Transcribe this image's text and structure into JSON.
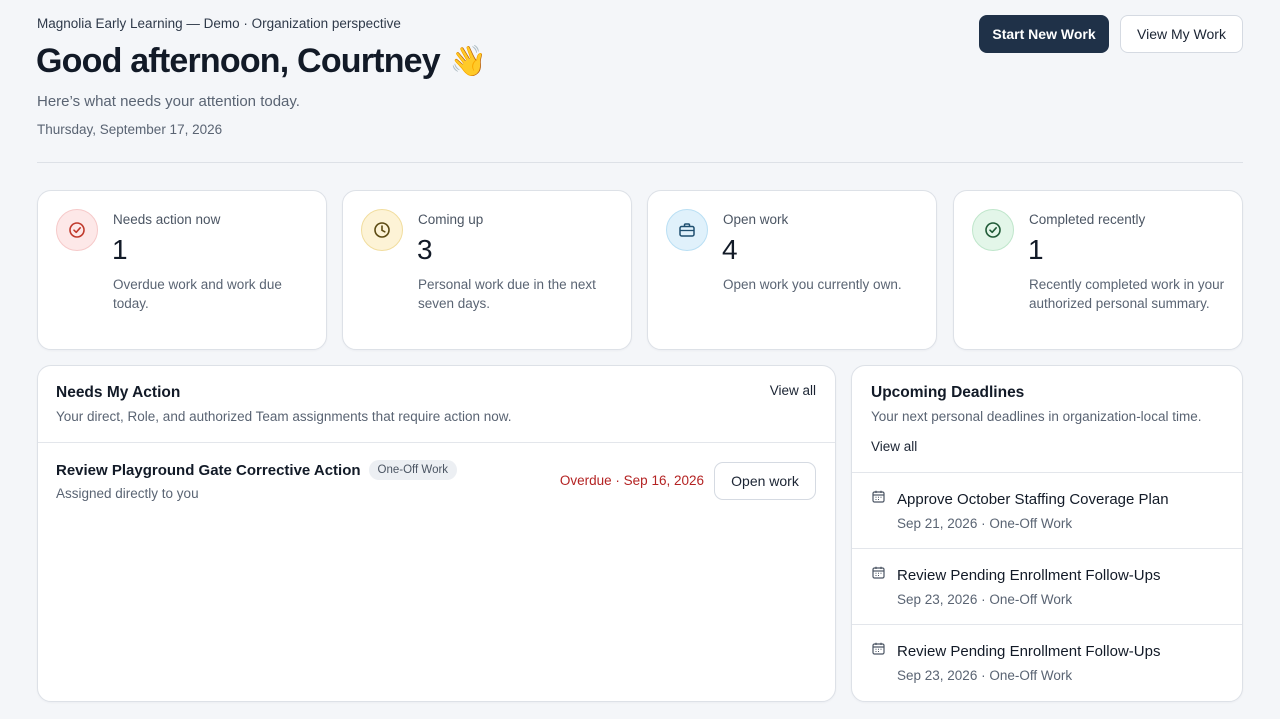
{
  "header": {
    "org_line": "Magnolia Early Learning — Demo · Organization perspective",
    "greeting": "Good afternoon, Courtney",
    "greeting_emoji": "👋",
    "subtitle": "Here’s what needs your attention today.",
    "date": "Thursday, September 17, 2026",
    "start_new_work_label": "Start New Work",
    "view_my_work_label": "View My Work"
  },
  "stats": [
    {
      "label": "Needs action now",
      "value": "1",
      "description": "Overdue work and work due today.",
      "icon": "alert-check-icon",
      "color": "#c0392b",
      "bg": "#fde8e8"
    },
    {
      "label": "Coming up",
      "value": "3",
      "description": "Personal work due in the next seven days.",
      "icon": "clock-icon",
      "color": "#8a6a10",
      "bg": "#fdf3d6"
    },
    {
      "label": "Open work",
      "value": "4",
      "description": "Open work you currently own.",
      "icon": "briefcase-icon",
      "color": "#1f6f9f",
      "bg": "#e0f1fb"
    },
    {
      "label": "Completed recently",
      "value": "1",
      "description": "Recently completed work in your authorized personal summary.",
      "icon": "check-circle-icon",
      "color": "#2b8a4e",
      "bg": "#e3f6e9"
    }
  ],
  "needs_action": {
    "title": "Needs My Action",
    "subtitle": "Your direct, Role, and authorized Team assignments that require action now.",
    "view_all_label": "View all",
    "items": [
      {
        "title": "Review Playground Gate Corrective Action",
        "chip": "One-Off Work",
        "assignment": "Assigned directly to you",
        "status": "Overdue · Sep 16, 2026",
        "action_label": "Open work"
      }
    ]
  },
  "deadlines": {
    "title": "Upcoming Deadlines",
    "subtitle": "Your next personal deadlines in organization-local time.",
    "view_all_label": "View all",
    "items": [
      {
        "title": "Approve October Staffing Coverage Plan",
        "meta": "Sep 21, 2026 · One-Off Work"
      },
      {
        "title": "Review Pending Enrollment Follow-Ups",
        "meta": "Sep 23, 2026 · One-Off Work"
      },
      {
        "title": "Review Pending Enrollment Follow-Ups",
        "meta": "Sep 23, 2026 · One-Off Work"
      }
    ]
  },
  "colors": {
    "primary": "#1f3148",
    "overdue": "#b42323",
    "background": "#f4f6f9"
  }
}
